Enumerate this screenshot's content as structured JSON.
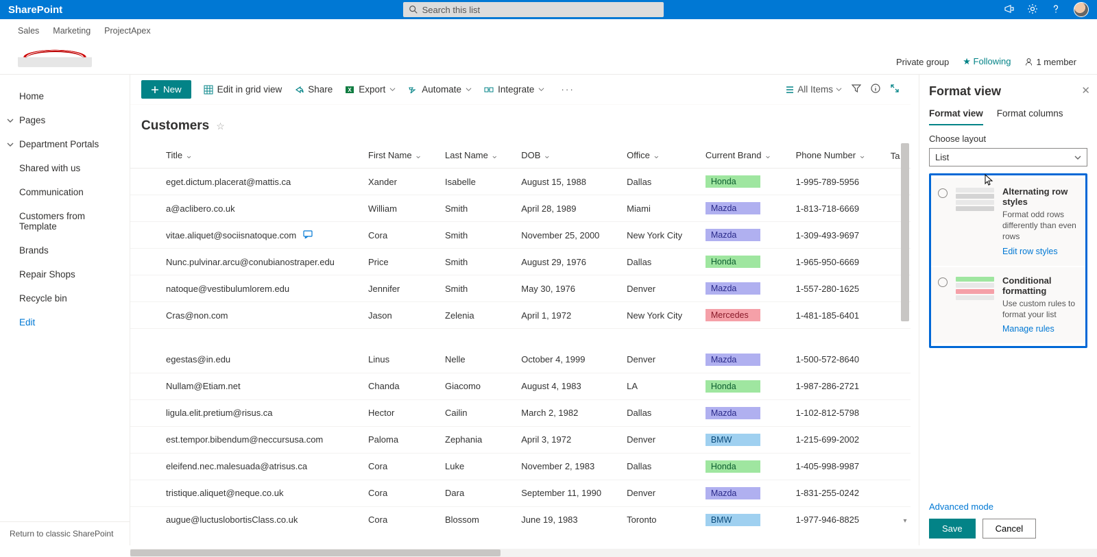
{
  "suite": {
    "brand": "SharePoint",
    "search_placeholder": "Search this list"
  },
  "breadcrumbs": [
    "Sales",
    "Marketing",
    "ProjectApex"
  ],
  "site_meta": {
    "group": "Private group",
    "following": "Following",
    "members": "1 member"
  },
  "nav": {
    "home": "Home",
    "pages": "Pages",
    "dept": "Department Portals",
    "shared": "Shared with us",
    "comm": "Communication",
    "cft": "Customers from Template",
    "brands": "Brands",
    "repair": "Repair Shops",
    "recycle": "Recycle bin",
    "edit": "Edit",
    "return": "Return to classic SharePoint"
  },
  "cmd": {
    "new": "New",
    "grid": "Edit in grid view",
    "share": "Share",
    "export": "Export",
    "automate": "Automate",
    "integrate": "Integrate",
    "view": "All Items"
  },
  "list": {
    "title": "Customers"
  },
  "cols": {
    "title": "Title",
    "first": "First Name",
    "last": "Last Name",
    "dob": "DOB",
    "office": "Office",
    "brand": "Current Brand",
    "phone": "Phone Number",
    "ta": "Ta"
  },
  "rows": [
    {
      "title": "eget.dictum.placerat@mattis.ca",
      "first": "Xander",
      "last": "Isabelle",
      "dob": "August 15, 1988",
      "office": "Dallas",
      "brand": "Honda",
      "phone": "1-995-789-5956"
    },
    {
      "title": "a@aclibero.co.uk",
      "first": "William",
      "last": "Smith",
      "dob": "April 28, 1989",
      "office": "Miami",
      "brand": "Mazda",
      "phone": "1-813-718-6669"
    },
    {
      "title": "vitae.aliquet@sociisnatoque.com",
      "first": "Cora",
      "last": "Smith",
      "dob": "November 25, 2000",
      "office": "New York City",
      "brand": "Mazda",
      "phone": "1-309-493-9697",
      "comment": true
    },
    {
      "title": "Nunc.pulvinar.arcu@conubianostraper.edu",
      "first": "Price",
      "last": "Smith",
      "dob": "August 29, 1976",
      "office": "Dallas",
      "brand": "Honda",
      "phone": "1-965-950-6669"
    },
    {
      "title": "natoque@vestibulumlorem.edu",
      "first": "Jennifer",
      "last": "Smith",
      "dob": "May 30, 1976",
      "office": "Denver",
      "brand": "Mazda",
      "phone": "1-557-280-1625"
    },
    {
      "title": "Cras@non.com",
      "first": "Jason",
      "last": "Zelenia",
      "dob": "April 1, 1972",
      "office": "New York City",
      "brand": "Mercedes",
      "phone": "1-481-185-6401"
    }
  ],
  "rows2": [
    {
      "title": "egestas@in.edu",
      "first": "Linus",
      "last": "Nelle",
      "dob": "October 4, 1999",
      "office": "Denver",
      "brand": "Mazda",
      "phone": "1-500-572-8640"
    },
    {
      "title": "Nullam@Etiam.net",
      "first": "Chanda",
      "last": "Giacomo",
      "dob": "August 4, 1983",
      "office": "LA",
      "brand": "Honda",
      "phone": "1-987-286-2721"
    },
    {
      "title": "ligula.elit.pretium@risus.ca",
      "first": "Hector",
      "last": "Cailin",
      "dob": "March 2, 1982",
      "office": "Dallas",
      "brand": "Mazda",
      "phone": "1-102-812-5798"
    },
    {
      "title": "est.tempor.bibendum@neccursusa.com",
      "first": "Paloma",
      "last": "Zephania",
      "dob": "April 3, 1972",
      "office": "Denver",
      "brand": "BMW",
      "phone": "1-215-699-2002"
    },
    {
      "title": "eleifend.nec.malesuada@atrisus.ca",
      "first": "Cora",
      "last": "Luke",
      "dob": "November 2, 1983",
      "office": "Dallas",
      "brand": "Honda",
      "phone": "1-405-998-9987"
    },
    {
      "title": "tristique.aliquet@neque.co.uk",
      "first": "Cora",
      "last": "Dara",
      "dob": "September 11, 1990",
      "office": "Denver",
      "brand": "Mazda",
      "phone": "1-831-255-0242"
    },
    {
      "title": "augue@luctuslobortisClass.co.uk",
      "first": "Cora",
      "last": "Blossom",
      "dob": "June 19, 1983",
      "office": "Toronto",
      "brand": "BMW",
      "phone": "1-977-946-8825"
    }
  ],
  "panel": {
    "title": "Format view",
    "tab1": "Format view",
    "tab2": "Format columns",
    "layout_label": "Choose layout",
    "layout_value": "List",
    "card1": {
      "t": "Alternating row styles",
      "d": "Format odd rows differently than even rows",
      "link": "Edit row styles"
    },
    "card2": {
      "t": "Conditional formatting",
      "d": "Use custom rules to format your list",
      "link": "Manage rules"
    },
    "adv": "Advanced mode",
    "save": "Save",
    "cancel": "Cancel"
  }
}
